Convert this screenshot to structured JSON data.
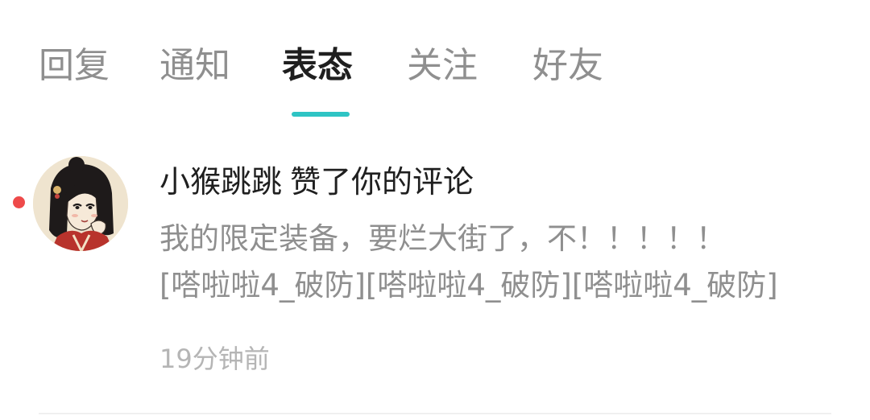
{
  "colors": {
    "accent": "#2ec4c4",
    "unread_dot": "#ee4a4a",
    "text_primary": "#1f1f1f",
    "text_secondary": "#8f8f8f",
    "text_tertiary": "#b5b5b5"
  },
  "tabs": [
    {
      "label": "回复",
      "active": false
    },
    {
      "label": "通知",
      "active": false
    },
    {
      "label": "表态",
      "active": true
    },
    {
      "label": "关注",
      "active": false
    },
    {
      "label": "好友",
      "active": false
    }
  ],
  "notifications": [
    {
      "unread": true,
      "avatar_icon": "avatar-illustration-girl",
      "username": "小猴跳跳",
      "action": "赞了你的评论",
      "comment_lines": [
        "我的限定装备，要烂大街了，不！！！！！",
        "[嗒啦啦4_破防][嗒啦啦4_破防][嗒啦啦4_破防]"
      ],
      "time": "19分钟前"
    }
  ]
}
